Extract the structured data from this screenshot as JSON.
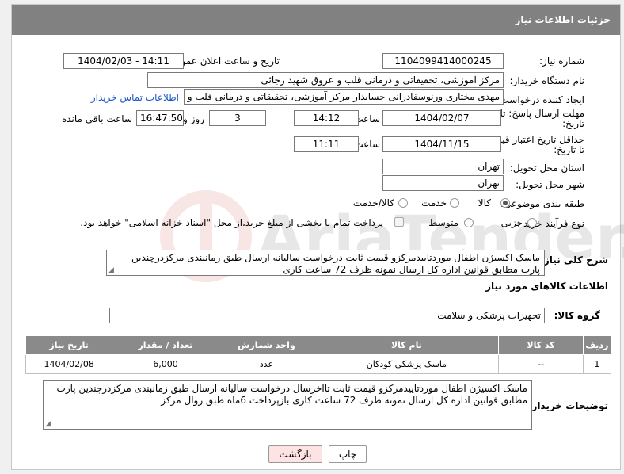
{
  "header": {
    "title": "جزئیات اطلاعات نیاز"
  },
  "labels": {
    "need_number": "شماره نیاز:",
    "announce_datetime": "تاریخ و ساعت اعلان عمومی:",
    "buyer_org": "نام دستگاه خریدار:",
    "requester": "ایجاد کننده درخواست:",
    "reply_deadline_line1": "مهلت ارسال پاسخ: تا",
    "reply_deadline_line2": "تاریخ:",
    "time": "ساعت",
    "day_and": "روز و",
    "hours_remaining": "ساعت باقی مانده",
    "price_validity_line1": "حداقل تاریخ اعتبار قیمت:",
    "price_validity_line2": "تا تاریخ:",
    "delivery_province": "استان محل تحویل:",
    "delivery_city": "شهر محل تحویل:",
    "category": "طبقه بندی موضوعی:",
    "purchase_process": "نوع فرآیند خرید :",
    "general_description": "شرح کلی نیاز:",
    "goods_info": "اطلاعات کالاهای مورد نیاز",
    "goods_group": "گروه کالا:",
    "buyer_notes": "توضیحات خریدار:"
  },
  "fields": {
    "need_number": "1104099414000245",
    "announce_datetime": "1404/02/03 - 14:11",
    "buyer_org": "مرکز آموزشی، تحقیقاتی و درمانی قلب و عروق شهید رجائی",
    "requester": "مهدی مختاری ورنوسفادرانی حسابدار مرکز آموزشی، تحقیقاتی و درمانی قلب و عروق",
    "contact_link": "اطلاعات تماس خریدار",
    "reply_date": "1404/02/07",
    "reply_time": "14:12",
    "reply_days": "3",
    "reply_remaining": "16:47:50",
    "validity_date": "1404/11/15",
    "validity_time": "11:11",
    "delivery_province": "تهران",
    "delivery_city": "تهران",
    "goods_group": "تجهیزات پزشکی و سلامت"
  },
  "category_options": [
    {
      "label": "کالا",
      "selected": true
    },
    {
      "label": "خدمت",
      "selected": false
    },
    {
      "label": "کالا/خدمت",
      "selected": false
    }
  ],
  "process_options": [
    {
      "label": "جزیی",
      "selected": false
    },
    {
      "label": "متوسط",
      "selected": false
    }
  ],
  "payment_note": "پرداخت تمام یا بخشی از مبلغ خرید،از محل \"اسناد خزانه اسلامی\" خواهد بود.",
  "general_description": "ماسک اکسیژن اطفال موردتاییدمرکزو قیمت ثابت درخواست سالیانه ارسال طبق زمانبندی مرکزدرچندین پارت مطابق قوانین اداره کل ارسال نمونه ظرف 72 ساعت کاری",
  "table": {
    "headers": [
      "ردیف",
      "کد کالا",
      "نام کالا",
      "واحد شمارش",
      "تعداد / مقدار",
      "تاریخ نیاز"
    ],
    "rows": [
      [
        "1",
        "--",
        "ماسک پزشکی کودکان",
        "عدد",
        "6,000",
        "1404/02/08"
      ]
    ]
  },
  "buyer_notes": "ماسک اکسیژن اطفال موردتاییدمرکزو قیمت ثابت تااخرسال درخواست سالیانه ارسال طبق زمانبندی مرکزدرچندین پارت مطابق قوانین اداره کل ارسال نمونه ظرف 72 ساعت کاری بازپرداخت 6ماه طبق روال مرکز",
  "buttons": {
    "print": "چاپ",
    "back": "بازگشت"
  },
  "watermark_text": "AriaTender.neT",
  "colors": {
    "header_bg": "#818181",
    "link": "#1a56c4",
    "back_button_bg": "#fde3e3"
  }
}
